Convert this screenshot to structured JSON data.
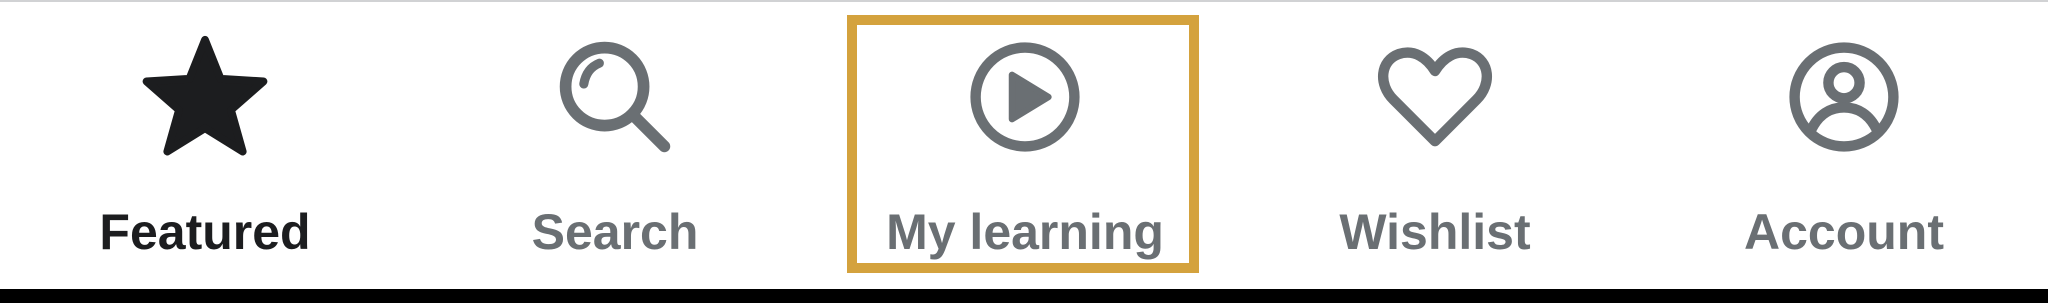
{
  "tabbar": {
    "tabs": [
      {
        "label": "Featured",
        "icon": "star-icon",
        "state": "active"
      },
      {
        "label": "Search",
        "icon": "search-icon",
        "state": "inactive"
      },
      {
        "label": "My learning",
        "icon": "play-circle-icon",
        "state": "inactive"
      },
      {
        "label": "Wishlist",
        "icon": "heart-icon",
        "state": "inactive"
      },
      {
        "label": "Account",
        "icon": "account-icon",
        "state": "inactive"
      }
    ],
    "highlighted_tab": "My learning"
  },
  "colors": {
    "active": "#1c1d1f",
    "inactive": "#6a6f73",
    "highlight": "#d4a23d",
    "background": "#ffffff"
  }
}
